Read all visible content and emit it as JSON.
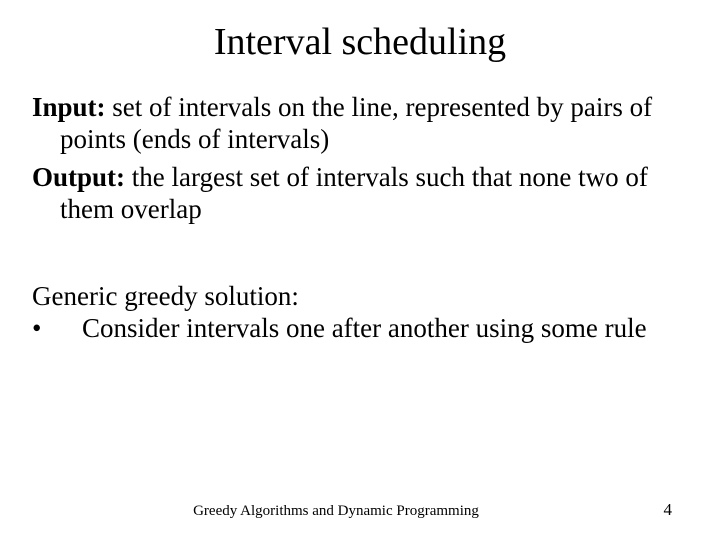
{
  "title": "Interval scheduling",
  "input_label": "Input:",
  "input_text": " set of intervals on the line, represented by pairs of points (ends of intervals)",
  "output_label": "Output:",
  "output_text": " the largest set of intervals such that none two of them overlap",
  "generic_heading": "Generic greedy solution:",
  "bullet_text": "Consider intervals one after another using some rule",
  "footer_title": "Greedy Algorithms and Dynamic Programming",
  "page_number": "4"
}
